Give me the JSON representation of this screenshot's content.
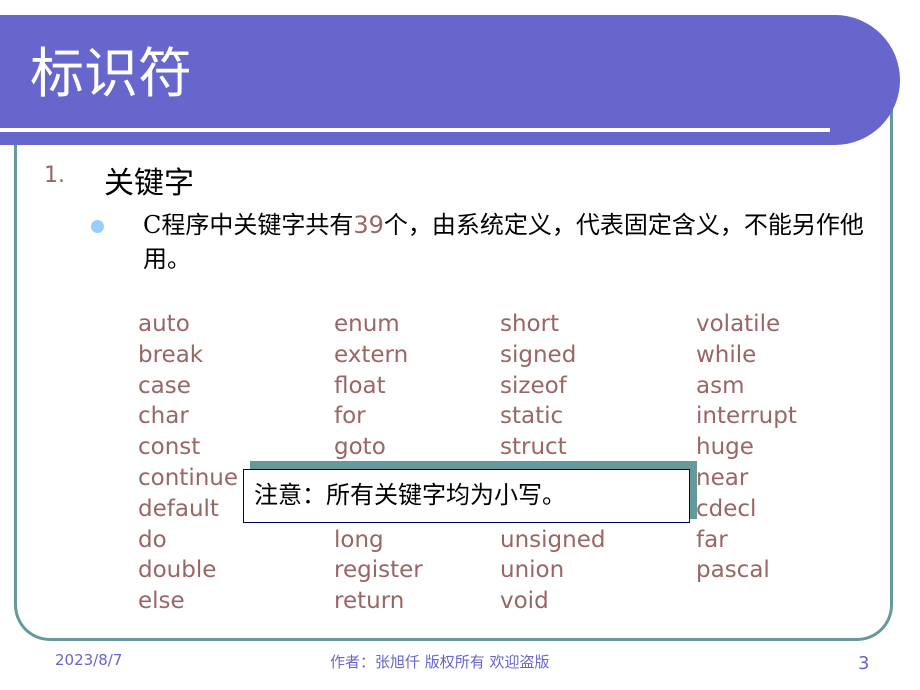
{
  "slide": {
    "title": "标识符",
    "section_number": "1.",
    "section_heading": "关键字",
    "paragraph": {
      "before": "C程序中关键字共有",
      "count": "39",
      "after": "个，由系统定义，代表固定含义，不能另作他用。"
    },
    "keyword_columns": [
      [
        "auto",
        "break",
        "case",
        "char",
        "const",
        "continue",
        "default",
        "do",
        "double",
        "else"
      ],
      [
        "enum",
        "extern",
        "float",
        "for",
        "goto",
        "",
        "",
        "long",
        "register",
        "return"
      ],
      [
        "short",
        "signed",
        "sizeof",
        "static",
        "struct",
        "",
        "",
        "unsigned",
        "union",
        "void"
      ],
      [
        "volatile",
        "while",
        "asm",
        "interrupt",
        "huge",
        "near",
        "cdecl",
        "far",
        "pascal"
      ]
    ],
    "note": "注意：所有关键字均为小写。"
  },
  "footer": {
    "date": "2023/8/7",
    "author": "作者：张旭仟 版权所有 欢迎盗版",
    "page": "3"
  },
  "colors": {
    "title_bar": "#6666cc",
    "frame": "#669999",
    "keyword": "#996666",
    "bullet": "#99ccff"
  }
}
